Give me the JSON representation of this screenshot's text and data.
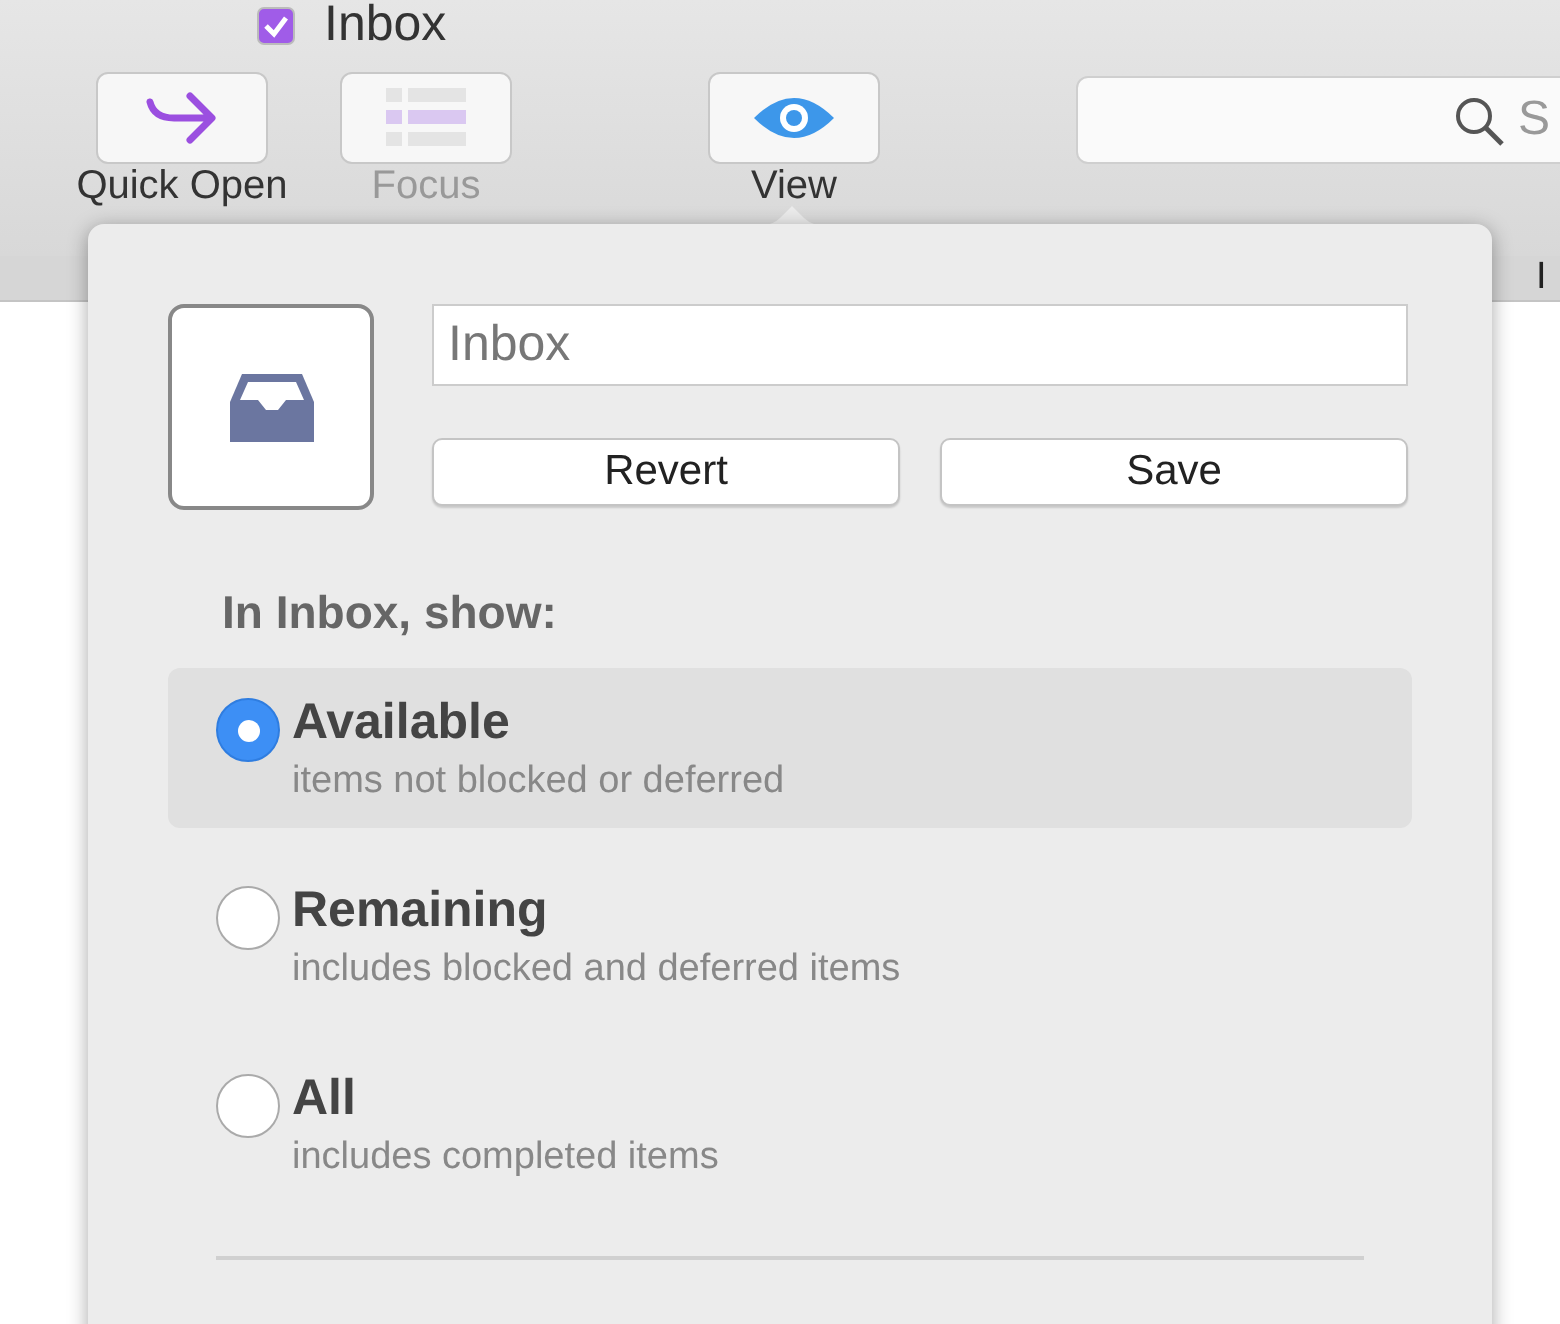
{
  "window": {
    "title": "Inbox",
    "checked": true
  },
  "toolbar": {
    "buttons": [
      {
        "label": "Quick Open",
        "disabled": false,
        "kind": "quick-open"
      },
      {
        "label": "Focus",
        "disabled": true,
        "kind": "focus"
      },
      {
        "label": "View",
        "disabled": false,
        "kind": "view"
      }
    ],
    "search": {
      "placeholder": "S"
    }
  },
  "column_header": "I",
  "popover": {
    "name_field": {
      "value": "Inbox"
    },
    "buttons": [
      "Revert",
      "Save"
    ],
    "heading": "In Inbox, show:",
    "options": [
      {
        "label": "Available",
        "description": "items not blocked or deferred",
        "selected": true
      },
      {
        "label": "Remaining",
        "description": "includes blocked and deferred items",
        "selected": false
      },
      {
        "label": "All",
        "description": "includes completed items",
        "selected": false
      }
    ]
  }
}
